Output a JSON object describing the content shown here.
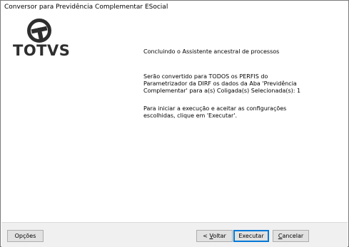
{
  "window": {
    "title": "Conversor para Previdência Complementar ESocial"
  },
  "logo": {
    "text": "TOTVS",
    "icon": "totvs-logo-icon"
  },
  "main": {
    "heading": "Concluindo o Assistente ancestral de processos",
    "paragraph1": "Serão convertido para TODOS os PERFIS do Parametrizador da DIRF os dados da Aba 'Previdência Complementar' para a(s) Coligada(s) Selecionada(s): 1",
    "paragraph2": "Para iniciar a execução e aceitar as configurações escolhidas, clique em 'Executar'."
  },
  "footer": {
    "options_label": "Opções",
    "back_prefix": "< ",
    "back_hotkey": "V",
    "back_rest": "oltar",
    "execute_label": "Executar",
    "cancel_hotkey": "C",
    "cancel_rest": "ancelar"
  },
  "colors": {
    "logo": "#2e2e2e",
    "default_button_border": "#0078d7",
    "footer_bg": "#f0f0f0"
  }
}
